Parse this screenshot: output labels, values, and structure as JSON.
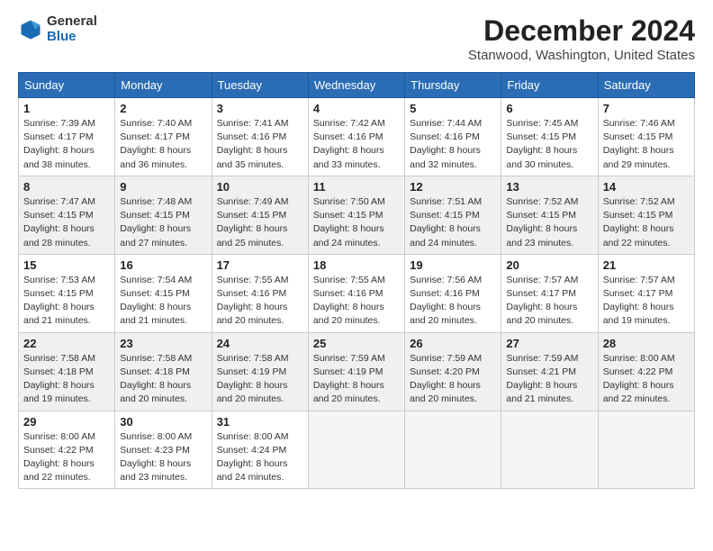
{
  "logo": {
    "general": "General",
    "blue": "Blue"
  },
  "title": "December 2024",
  "subtitle": "Stanwood, Washington, United States",
  "days_of_week": [
    "Sunday",
    "Monday",
    "Tuesday",
    "Wednesday",
    "Thursday",
    "Friday",
    "Saturday"
  ],
  "weeks": [
    [
      {
        "day": "1",
        "sunrise": "Sunrise: 7:39 AM",
        "sunset": "Sunset: 4:17 PM",
        "daylight": "Daylight: 8 hours and 38 minutes."
      },
      {
        "day": "2",
        "sunrise": "Sunrise: 7:40 AM",
        "sunset": "Sunset: 4:17 PM",
        "daylight": "Daylight: 8 hours and 36 minutes."
      },
      {
        "day": "3",
        "sunrise": "Sunrise: 7:41 AM",
        "sunset": "Sunset: 4:16 PM",
        "daylight": "Daylight: 8 hours and 35 minutes."
      },
      {
        "day": "4",
        "sunrise": "Sunrise: 7:42 AM",
        "sunset": "Sunset: 4:16 PM",
        "daylight": "Daylight: 8 hours and 33 minutes."
      },
      {
        "day": "5",
        "sunrise": "Sunrise: 7:44 AM",
        "sunset": "Sunset: 4:16 PM",
        "daylight": "Daylight: 8 hours and 32 minutes."
      },
      {
        "day": "6",
        "sunrise": "Sunrise: 7:45 AM",
        "sunset": "Sunset: 4:15 PM",
        "daylight": "Daylight: 8 hours and 30 minutes."
      },
      {
        "day": "7",
        "sunrise": "Sunrise: 7:46 AM",
        "sunset": "Sunset: 4:15 PM",
        "daylight": "Daylight: 8 hours and 29 minutes."
      }
    ],
    [
      {
        "day": "8",
        "sunrise": "Sunrise: 7:47 AM",
        "sunset": "Sunset: 4:15 PM",
        "daylight": "Daylight: 8 hours and 28 minutes."
      },
      {
        "day": "9",
        "sunrise": "Sunrise: 7:48 AM",
        "sunset": "Sunset: 4:15 PM",
        "daylight": "Daylight: 8 hours and 27 minutes."
      },
      {
        "day": "10",
        "sunrise": "Sunrise: 7:49 AM",
        "sunset": "Sunset: 4:15 PM",
        "daylight": "Daylight: 8 hours and 25 minutes."
      },
      {
        "day": "11",
        "sunrise": "Sunrise: 7:50 AM",
        "sunset": "Sunset: 4:15 PM",
        "daylight": "Daylight: 8 hours and 24 minutes."
      },
      {
        "day": "12",
        "sunrise": "Sunrise: 7:51 AM",
        "sunset": "Sunset: 4:15 PM",
        "daylight": "Daylight: 8 hours and 24 minutes."
      },
      {
        "day": "13",
        "sunrise": "Sunrise: 7:52 AM",
        "sunset": "Sunset: 4:15 PM",
        "daylight": "Daylight: 8 hours and 23 minutes."
      },
      {
        "day": "14",
        "sunrise": "Sunrise: 7:52 AM",
        "sunset": "Sunset: 4:15 PM",
        "daylight": "Daylight: 8 hours and 22 minutes."
      }
    ],
    [
      {
        "day": "15",
        "sunrise": "Sunrise: 7:53 AM",
        "sunset": "Sunset: 4:15 PM",
        "daylight": "Daylight: 8 hours and 21 minutes."
      },
      {
        "day": "16",
        "sunrise": "Sunrise: 7:54 AM",
        "sunset": "Sunset: 4:15 PM",
        "daylight": "Daylight: 8 hours and 21 minutes."
      },
      {
        "day": "17",
        "sunrise": "Sunrise: 7:55 AM",
        "sunset": "Sunset: 4:16 PM",
        "daylight": "Daylight: 8 hours and 20 minutes."
      },
      {
        "day": "18",
        "sunrise": "Sunrise: 7:55 AM",
        "sunset": "Sunset: 4:16 PM",
        "daylight": "Daylight: 8 hours and 20 minutes."
      },
      {
        "day": "19",
        "sunrise": "Sunrise: 7:56 AM",
        "sunset": "Sunset: 4:16 PM",
        "daylight": "Daylight: 8 hours and 20 minutes."
      },
      {
        "day": "20",
        "sunrise": "Sunrise: 7:57 AM",
        "sunset": "Sunset: 4:17 PM",
        "daylight": "Daylight: 8 hours and 20 minutes."
      },
      {
        "day": "21",
        "sunrise": "Sunrise: 7:57 AM",
        "sunset": "Sunset: 4:17 PM",
        "daylight": "Daylight: 8 hours and 19 minutes."
      }
    ],
    [
      {
        "day": "22",
        "sunrise": "Sunrise: 7:58 AM",
        "sunset": "Sunset: 4:18 PM",
        "daylight": "Daylight: 8 hours and 19 minutes."
      },
      {
        "day": "23",
        "sunrise": "Sunrise: 7:58 AM",
        "sunset": "Sunset: 4:18 PM",
        "daylight": "Daylight: 8 hours and 20 minutes."
      },
      {
        "day": "24",
        "sunrise": "Sunrise: 7:58 AM",
        "sunset": "Sunset: 4:19 PM",
        "daylight": "Daylight: 8 hours and 20 minutes."
      },
      {
        "day": "25",
        "sunrise": "Sunrise: 7:59 AM",
        "sunset": "Sunset: 4:19 PM",
        "daylight": "Daylight: 8 hours and 20 minutes."
      },
      {
        "day": "26",
        "sunrise": "Sunrise: 7:59 AM",
        "sunset": "Sunset: 4:20 PM",
        "daylight": "Daylight: 8 hours and 20 minutes."
      },
      {
        "day": "27",
        "sunrise": "Sunrise: 7:59 AM",
        "sunset": "Sunset: 4:21 PM",
        "daylight": "Daylight: 8 hours and 21 minutes."
      },
      {
        "day": "28",
        "sunrise": "Sunrise: 8:00 AM",
        "sunset": "Sunset: 4:22 PM",
        "daylight": "Daylight: 8 hours and 22 minutes."
      }
    ],
    [
      {
        "day": "29",
        "sunrise": "Sunrise: 8:00 AM",
        "sunset": "Sunset: 4:22 PM",
        "daylight": "Daylight: 8 hours and 22 minutes."
      },
      {
        "day": "30",
        "sunrise": "Sunrise: 8:00 AM",
        "sunset": "Sunset: 4:23 PM",
        "daylight": "Daylight: 8 hours and 23 minutes."
      },
      {
        "day": "31",
        "sunrise": "Sunrise: 8:00 AM",
        "sunset": "Sunset: 4:24 PM",
        "daylight": "Daylight: 8 hours and 24 minutes."
      },
      null,
      null,
      null,
      null
    ]
  ]
}
